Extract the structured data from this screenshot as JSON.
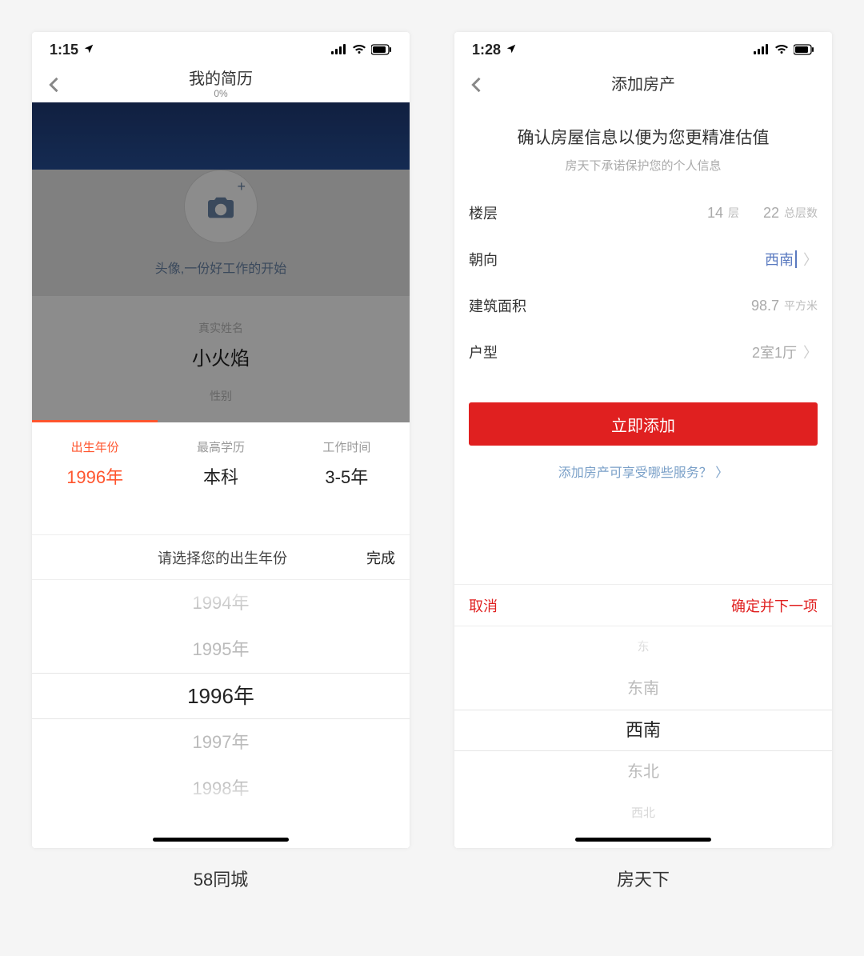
{
  "left": {
    "caption": "58同城",
    "status_time": "1:15",
    "nav_title": "我的简历",
    "nav_sub": "0%",
    "avatar_hint": "头像,一份好工作的开始",
    "name_label": "真实姓名",
    "name_value": "小火焰",
    "gender_label": "性别",
    "tabs": [
      {
        "label": "出生年份",
        "value": "1996年",
        "active": true
      },
      {
        "label": "最高学历",
        "value": "本科",
        "active": false
      },
      {
        "label": "工作时间",
        "value": "3-5年",
        "active": false
      }
    ],
    "picker_title": "请选择您的出生年份",
    "picker_done": "完成",
    "picker_options": [
      "1994年",
      "1995年",
      "1996年",
      "1997年",
      "1998年"
    ],
    "picker_selected": "1996年"
  },
  "right": {
    "caption": "房天下",
    "status_time": "1:28",
    "nav_title": "添加房产",
    "lead_title": "确认房屋信息以便为您更精准估值",
    "lead_sub": "房天下承诺保护您的个人信息",
    "rows": {
      "floor_label": "楼层",
      "floor_value": "14",
      "floor_unit": "层",
      "total_value": "22",
      "total_unit": "总层数",
      "orient_label": "朝向",
      "orient_value": "西南",
      "area_label": "建筑面积",
      "area_value": "98.7",
      "area_unit": "平方米",
      "layout_label": "户型",
      "layout_value": "2室1厅"
    },
    "cta": "立即添加",
    "link": "添加房产可享受哪些服务？",
    "sheet_cancel": "取消",
    "sheet_confirm": "确定并下一项",
    "sheet_options": [
      "东",
      "东南",
      "西南",
      "东北",
      "西北"
    ],
    "sheet_selected": "西南"
  }
}
